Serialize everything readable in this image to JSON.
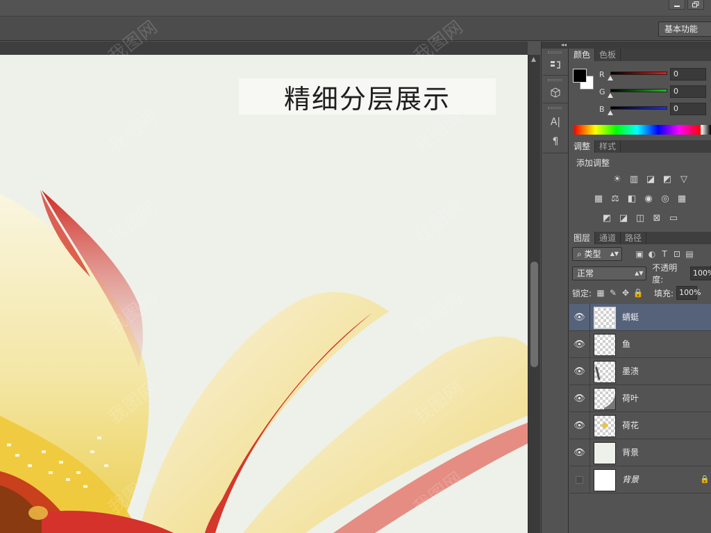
{
  "window": {
    "minimize_icon": "minimize-icon",
    "restore_icon": "restore-icon"
  },
  "options_bar": {
    "workspace": "基本功能"
  },
  "canvas": {
    "caption": "精细分层展示"
  },
  "watermark": {
    "text": "我图网"
  },
  "dock": {
    "icons": [
      "history-icon",
      "3d-icon",
      "character-icon",
      "paragraph-icon"
    ]
  },
  "color_panel": {
    "tabs": [
      "颜色",
      "色板"
    ],
    "channels": [
      {
        "label": "R",
        "value": "0",
        "color": "#e02020"
      },
      {
        "label": "G",
        "value": "0",
        "color": "#20c020"
      },
      {
        "label": "B",
        "value": "0",
        "color": "#2030e0"
      }
    ],
    "foreground": "#000000",
    "background": "#ffffff"
  },
  "adjustments_panel": {
    "tabs": [
      "调整",
      "样式"
    ],
    "title": "添加调整",
    "icons_row1": [
      "☀",
      "▥",
      "◪",
      "◩",
      "▽"
    ],
    "icons_row2": [
      "▦",
      "⚖",
      "◧",
      "◉",
      "◎",
      "▦"
    ],
    "icons_row3": [
      "◩",
      "◪",
      "◫",
      "⊠",
      "▭"
    ]
  },
  "layers_panel": {
    "tabs": [
      "图层",
      "通道",
      "路径"
    ],
    "filter_label": "类型",
    "filter_icons": [
      "▣",
      "◐",
      "T",
      "⊡",
      "▤"
    ],
    "blend_mode": "正常",
    "opacity_label": "不透明度:",
    "opacity_value": "100%",
    "lock_label": "锁定:",
    "lock_icons": [
      "▦",
      "✎",
      "✥",
      "🔒"
    ],
    "fill_label": "填充:",
    "fill_value": "100%",
    "layers": [
      {
        "name": "蜻蜓",
        "visible": true,
        "selected": true
      },
      {
        "name": "鱼",
        "visible": true,
        "selected": false
      },
      {
        "name": "墨渍",
        "visible": true,
        "selected": false
      },
      {
        "name": "荷叶",
        "visible": true,
        "selected": false
      },
      {
        "name": "荷花",
        "visible": true,
        "selected": false
      },
      {
        "name": "背景",
        "visible": true,
        "selected": false
      },
      {
        "name": "背景",
        "visible": false,
        "selected": false,
        "locked": true
      }
    ]
  }
}
